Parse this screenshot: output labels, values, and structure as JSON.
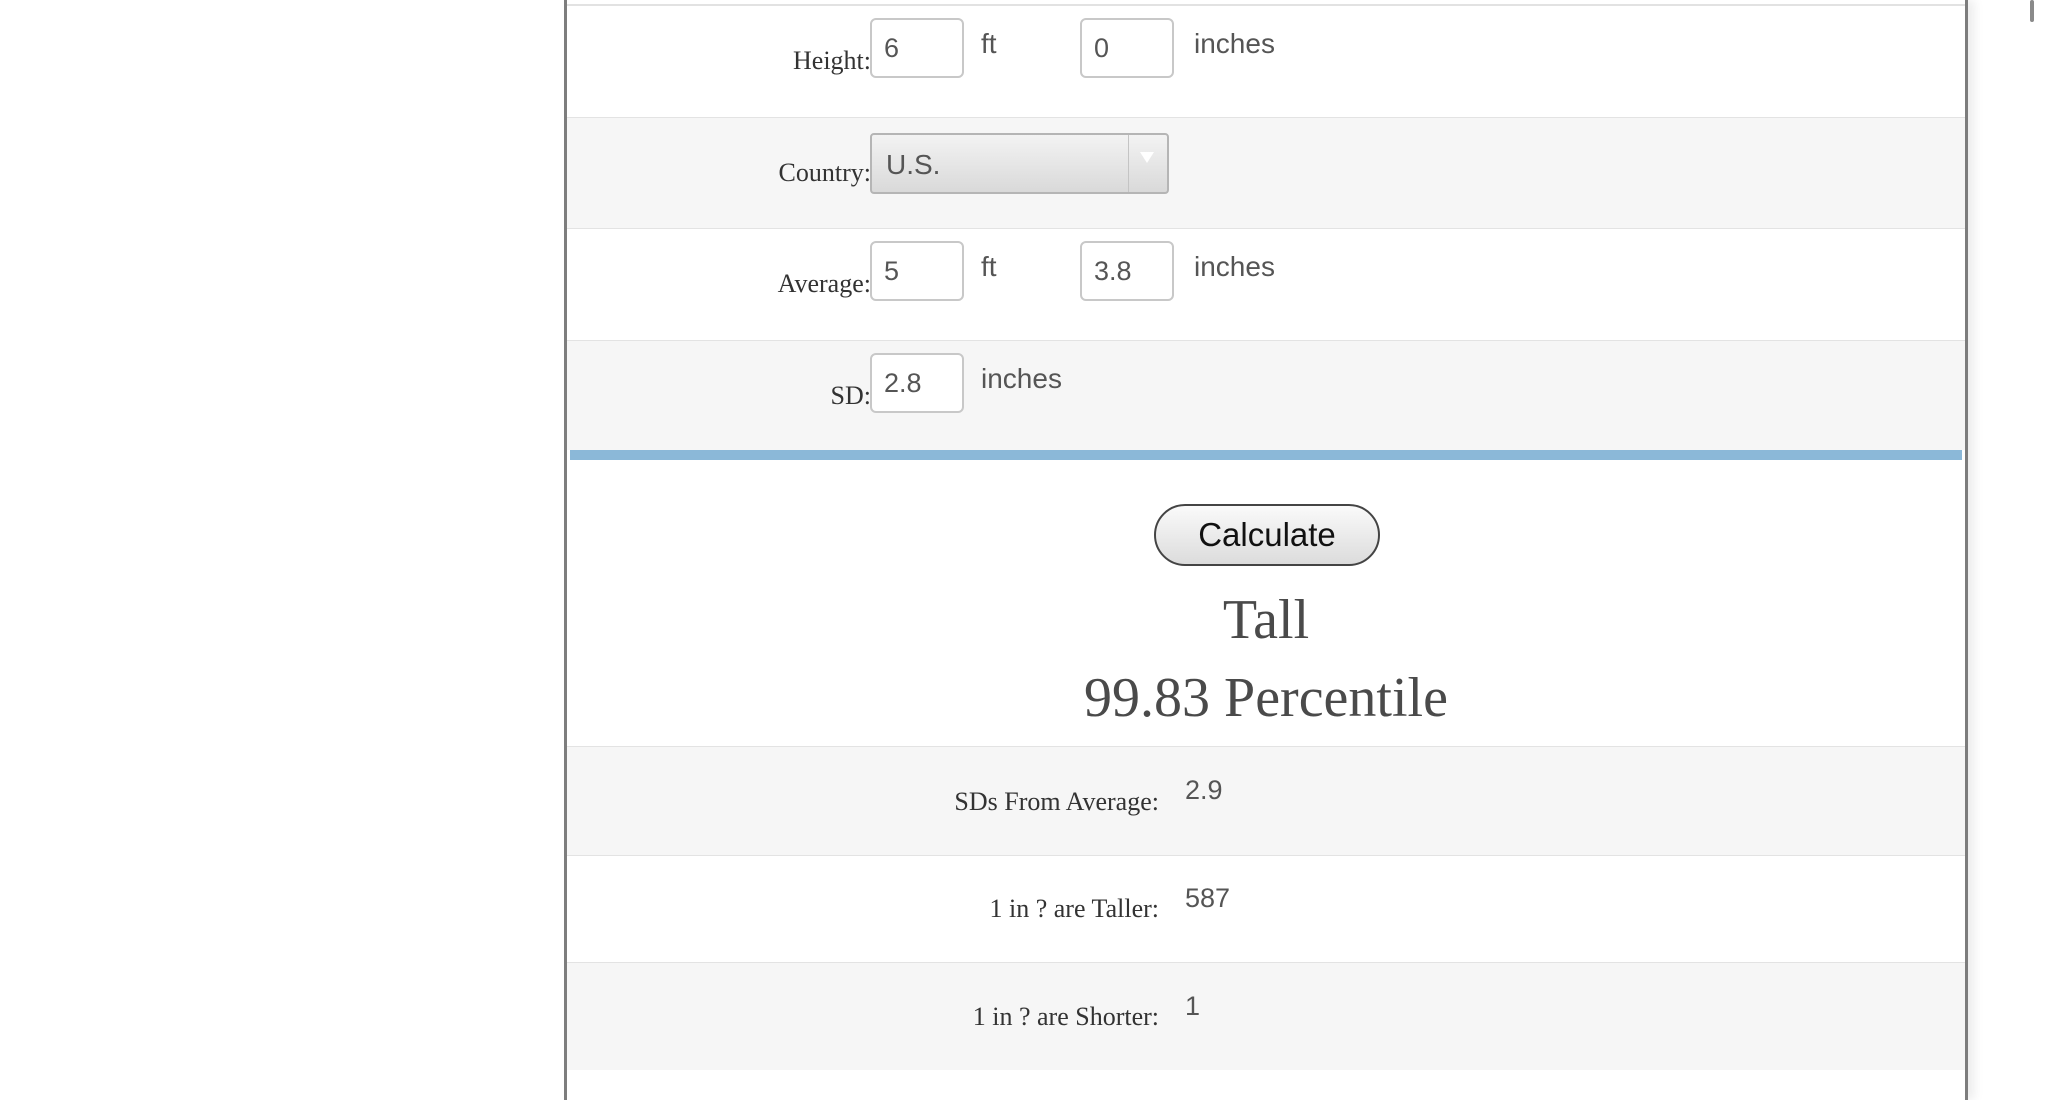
{
  "form": {
    "height": {
      "label": "Height:",
      "feet": "6",
      "feet_unit": "ft",
      "inches": "0",
      "inches_unit": "inches"
    },
    "country": {
      "label": "Country:",
      "selected": "U.S."
    },
    "average": {
      "label": "Average:",
      "feet": "5",
      "feet_unit": "ft",
      "inches": "3.8",
      "inches_unit": "inches"
    },
    "sd": {
      "label": "SD:",
      "value": "2.8",
      "unit": "inches"
    }
  },
  "calculate_label": "Calculate",
  "result": {
    "category": "Tall",
    "percentile": "99.83 Percentile"
  },
  "stats": [
    {
      "label": "SDs From Average:",
      "value": "2.9"
    },
    {
      "label": "1 in ? are Taller:",
      "value": "587"
    },
    {
      "label": "1 in ? are Shorter:",
      "value": "1"
    }
  ],
  "colors": {
    "accent_bar": "#8bb8d8",
    "alt_row": "#f6f6f6",
    "border": "#7d7d7d"
  }
}
